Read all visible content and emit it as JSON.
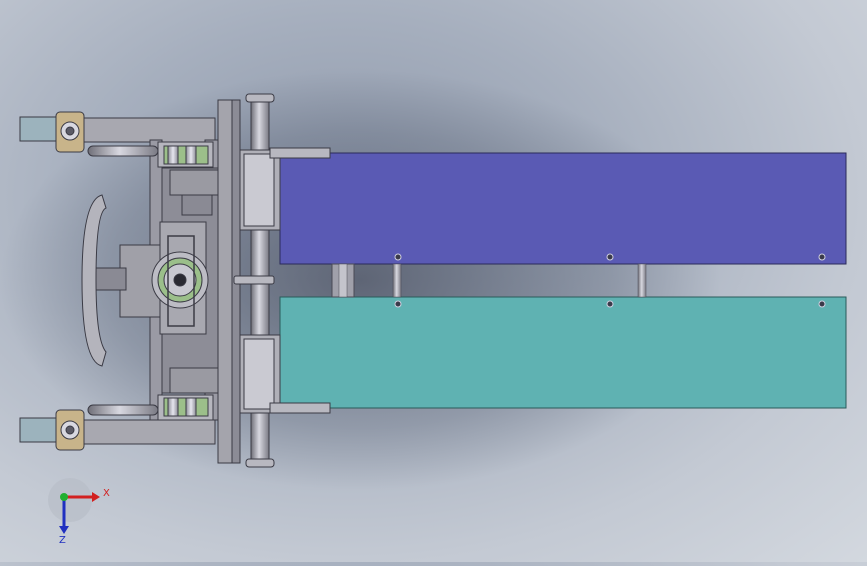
{
  "viewport": {
    "background_colors": [
      "#8f99ab",
      "#c3c9d3"
    ],
    "shadow_color": "#5c6577"
  },
  "model": {
    "upper_panel_color": "#5a5ab4",
    "lower_panel_color": "#5fb2b2",
    "frame_color": "#a8a8b0",
    "dark_frame_color": "#7d7d86",
    "tan_color": "#c8b48a",
    "teal_pad_color": "#9cb3bd",
    "green_ring_color": "#9bbf8a"
  },
  "triad": {
    "x_label": "X",
    "z_label": "Z",
    "x_color": "#d22020",
    "z_color": "#2030c0",
    "origin_color": "#20b030"
  }
}
